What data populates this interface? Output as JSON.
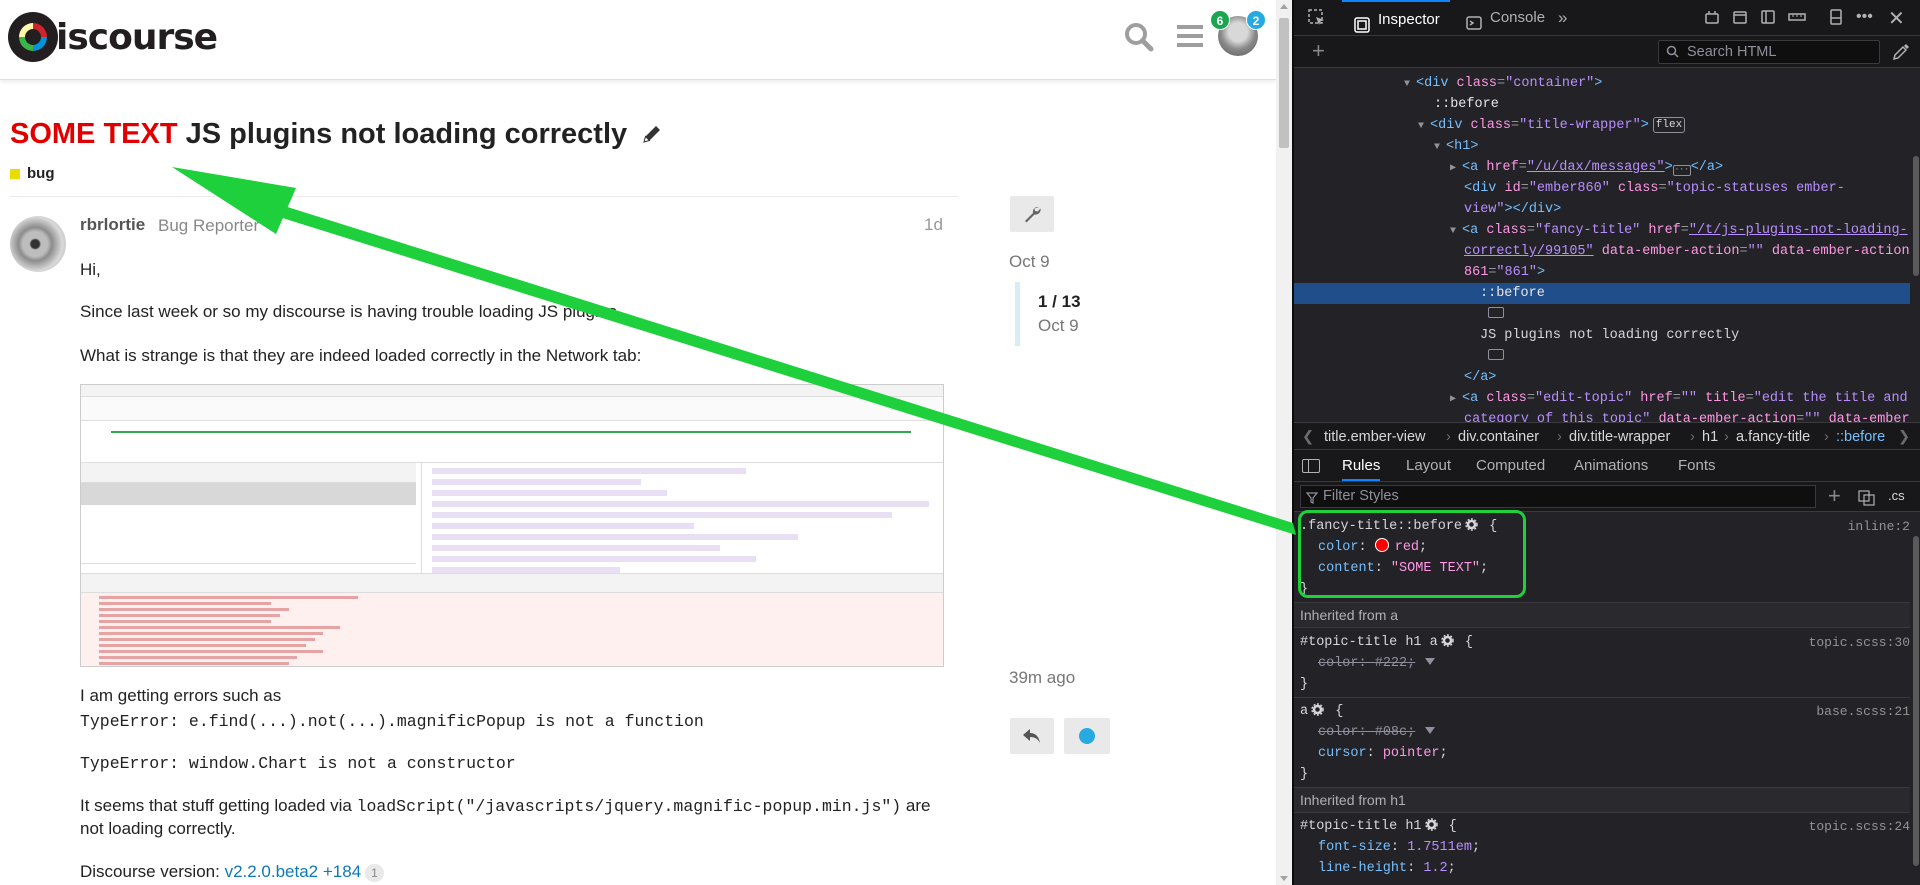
{
  "site": {
    "logo_text": "iscourse",
    "notifications_count": "6",
    "messages_count": "2"
  },
  "topic": {
    "title_prefix": "SOME TEXT",
    "title": "JS plugins not loading correctly",
    "category": "bug"
  },
  "post": {
    "username": "rbrlortie",
    "user_title": "Bug Reporter",
    "age": "1d",
    "greeting": "Hi,",
    "p1": "Since last week or so my discourse is having trouble loading JS plugins.",
    "p2": "What is strange is that they are indeed loaded correctly in the Network tab:",
    "p3": "I am getting errors such as",
    "error1": "TypeError: e.find(...).not(...).magnificPopup is not a function",
    "error2": "TypeError: window.Chart is not a constructor",
    "p4_pre": "It seems that stuff getting loaded via ",
    "p4_code": "loadScript(\"/javascripts/jquery.magnific-popup.min.js\")",
    "p4_post": " are",
    "p4_line2": "not loading correctly.",
    "version_label": "Discourse version: ",
    "version_link": "v2.2.0.beta2 +184",
    "version_count": "1"
  },
  "timeline": {
    "start_date": "Oct 9",
    "position": "1 / 13",
    "position_date": "Oct 9",
    "end_label": "39m ago"
  },
  "devtools": {
    "tabs": {
      "inspector": "Inspector",
      "console": "Console",
      "more": "»"
    },
    "search_placeholder": "Search HTML",
    "markup": {
      "l1_tag": "<div ",
      "l1_attr": "class",
      "l1_val": "\"container\"",
      "l1_end": ">",
      "l2": "::before",
      "l3_tag": "<div ",
      "l3_attr": "class",
      "l3_val": "\"title-wrapper\"",
      "l3_end": ">",
      "l3_badge": "flex",
      "l4": "<h1>",
      "l5_tag": "<a ",
      "l5_attr": "href",
      "l5_val": "\"/u/dax/messages\"",
      "l5_mid": ">",
      "l5_ell": "···",
      "l5_end": "</a>",
      "l6_tag": "<div ",
      "l6_attr1": "id",
      "l6_val1": "\"ember860\"",
      "l6_attr2": " class",
      "l6_val2": "\"topic-statuses ember-",
      "l7_val": "view\"",
      "l7_end": "></div>",
      "l8_tag": "<a ",
      "l8_attr1": "class",
      "l8_val1": "\"fancy-title\"",
      "l8_attr2": " href",
      "l8_val2": "\"/t/js-plugins-not-loading-",
      "l9_val": "correctly/99105\"",
      "l9_attr": " data-ember-action",
      "l9_val2": "\"\"",
      "l9_attr2": " data-ember-action-",
      "l10_attr": "861",
      "l10_val": "\"861\"",
      "l10_end": ">",
      "l11": "::before",
      "l13": "JS plugins not loading correctly",
      "l15": "</a>",
      "l16_tag": "<a ",
      "l16_attr1": "class",
      "l16_val1": "\"edit-topic\"",
      "l16_attr2": " href",
      "l16_val2": "\"\"",
      "l16_attr3": " title",
      "l16_val3": "\"edit the title and",
      "l17_val": "category of this topic\"",
      "l17_attr": " data-ember-action",
      "l17_val2": "\"\"",
      "l17_attr2": " data-ember-"
    },
    "breadcrumbs": [
      "title.ember-view",
      "div.container",
      "div.title-wrapper",
      "h1",
      "a.fancy-title",
      "::before"
    ],
    "rules_tabs": [
      "Rules",
      "Layout",
      "Computed",
      "Animations",
      "Fonts"
    ],
    "filter_placeholder": "Filter Styles",
    "cls_label": ".cs",
    "rules": {
      "r1_selector": ".fancy-title::before",
      "r1_source": "inline:2",
      "r1_p1": "color",
      "r1_v1": "red",
      "r1_p2": "content",
      "r1_v2": "\"SOME TEXT\"",
      "inherited_a": "Inherited from a",
      "r2_selector": "#topic-title h1 a",
      "r2_source": "topic.scss:30",
      "r2_p1": "color",
      "r2_v1": "#222",
      "r3_selector": "a",
      "r3_source": "base.scss:21",
      "r3_p1": "color",
      "r3_v1": "#08c",
      "r3_p2": "cursor",
      "r3_v2": "pointer",
      "inherited_h1": "Inherited from h1",
      "r4_selector": "#topic-title h1",
      "r4_source": "topic.scss:24",
      "r4_p1": "font-size",
      "r4_v1": "1.7511em",
      "r4_p2": "line-height",
      "r4_v2": "1.2"
    }
  },
  "colors": {
    "title_prefix": "#e00000",
    "annotation": "#1ed03c",
    "link": "#0e78b8",
    "devtools_bg": "#232327",
    "selection": "#204e8a"
  }
}
